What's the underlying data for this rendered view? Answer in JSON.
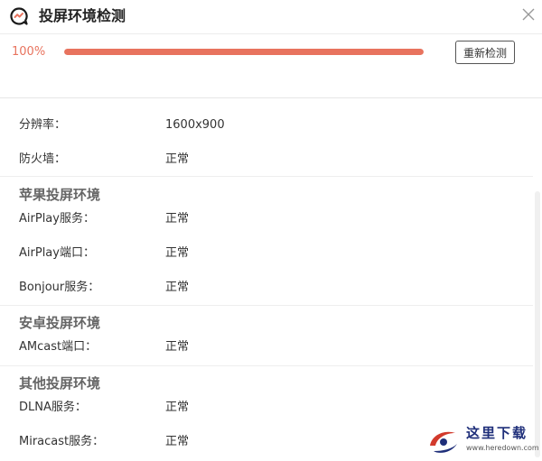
{
  "window": {
    "title": "投屏环境检测",
    "close_icon": "close-icon",
    "app_icon": "speech-bubble-check-icon"
  },
  "progress": {
    "percent_label": "100%",
    "value": 1.0,
    "recheck_label": "重新检测",
    "color": "#e8735e"
  },
  "general": {
    "resolution": {
      "label": "分辨率：",
      "value": "1600x900"
    },
    "firewall": {
      "label": "防火墙：",
      "value": "正常"
    }
  },
  "apple": {
    "heading": "苹果投屏环境",
    "airplay_service": {
      "label": "AirPlay服务：",
      "value": "正常"
    },
    "airplay_port": {
      "label": "AirPlay端口：",
      "value": "正常"
    },
    "bonjour_service": {
      "label": "Bonjour服务：",
      "value": "正常"
    }
  },
  "android": {
    "heading": "安卓投屏环境",
    "amcast_port": {
      "label": "AMcast端口：",
      "value": "正常"
    }
  },
  "other": {
    "heading": "其他投屏环境",
    "dlna_service": {
      "label": "DLNA服务：",
      "value": "正常"
    },
    "miracast_service": {
      "label": "Miracast服务：",
      "value": "正常"
    }
  },
  "watermark": {
    "text": "这里下载",
    "url": "www.heredown.com"
  }
}
